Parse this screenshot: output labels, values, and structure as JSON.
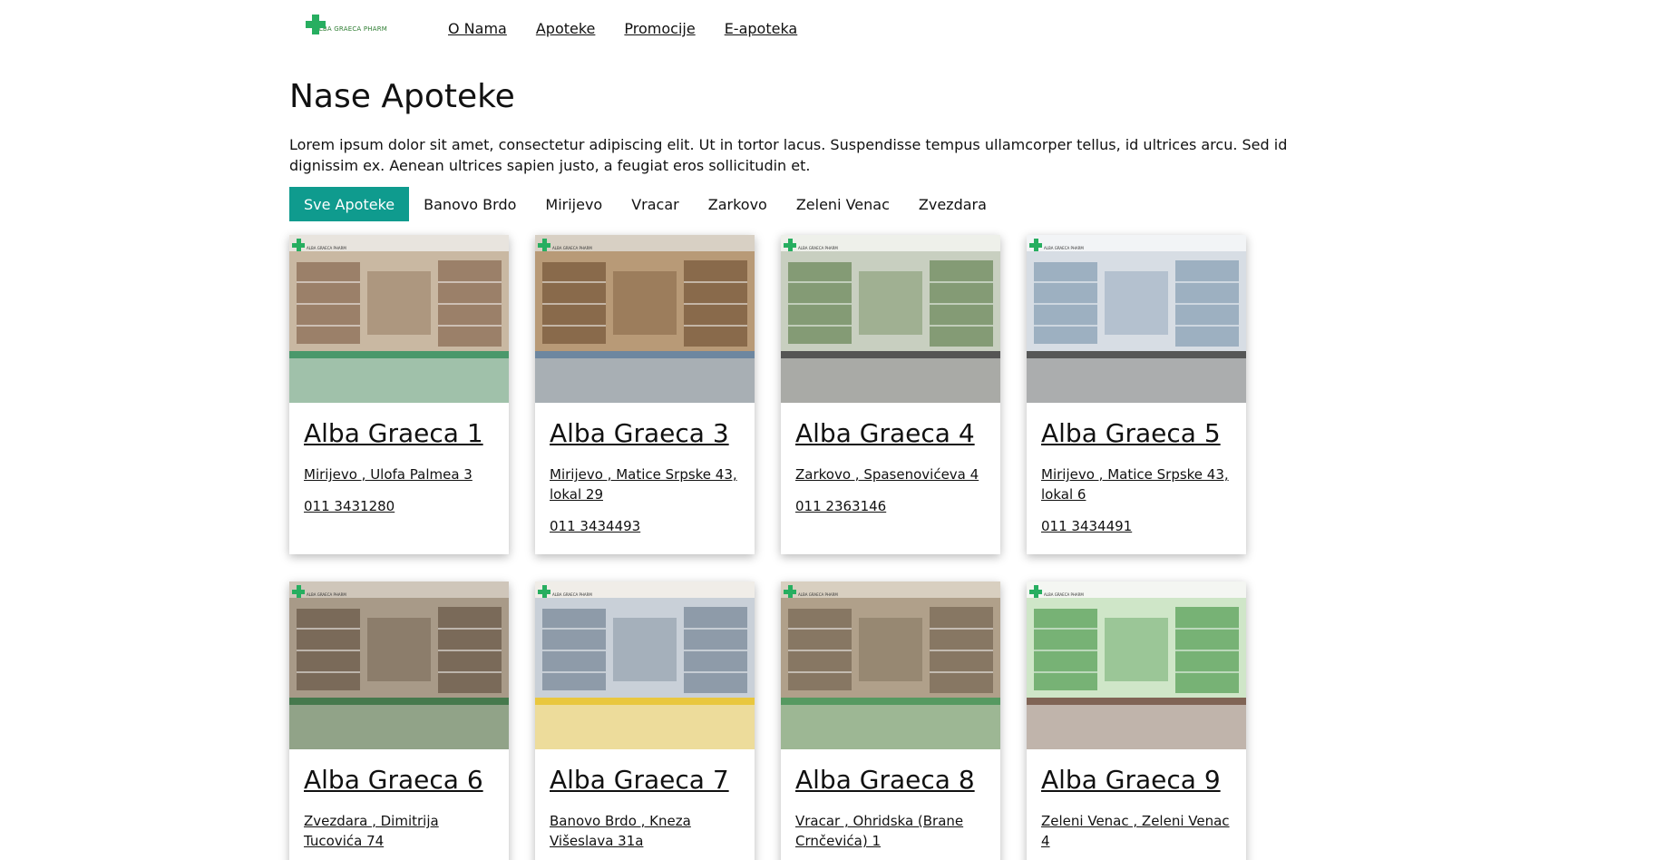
{
  "brand": {
    "logo_text": "ALBA GRAECA PHARM"
  },
  "nav": {
    "items": [
      "O Nama",
      "Apoteke",
      "Promocije",
      "E-apoteka"
    ]
  },
  "main": {
    "title": "Nase Apoteke",
    "intro": "Lorem ipsum dolor sit amet, consectetur adipiscing elit. Ut in tortor lacus. Suspendisse tempus ullamcorper tellus, id ultrices arcu. Sed id dignissim ex. Aenean ultrices sapien justo, a feugiat eros sollicitudin et.",
    "filters": [
      "Sve Apoteke",
      "Banovo Brdo",
      "Mirijevo",
      "Vracar",
      "Zarkovo",
      "Zeleni Venac",
      "Zvezdara"
    ],
    "active_filter": "Sve Apoteke"
  },
  "pharmacies": [
    {
      "name": "Alba Graeca 1",
      "address": "Mirijevo , Ulofa Palmea 3",
      "phone": "011 3431280",
      "palette": [
        "#8b6e55",
        "#c9b8a2",
        "#2e8b57",
        "#e8e4de"
      ]
    },
    {
      "name": "Alba Graeca 3",
      "address": "Mirijevo , Matice Srpske 43, lokal 29",
      "phone": "011 3434493",
      "palette": [
        "#7a5a3c",
        "#b89a77",
        "#5a7a9a",
        "#d8d0c4"
      ]
    },
    {
      "name": "Alba Graeca 4",
      "address": "Zarkovo , Spasenovićeva 4",
      "phone": "011 2363146",
      "palette": [
        "#6e8a5c",
        "#c8cfc0",
        "#3a3a3a",
        "#eef0ea"
      ]
    },
    {
      "name": "Alba Graeca 5",
      "address": "Mirijevo , Matice Srpske 43, lokal 6",
      "phone": "011 3434491",
      "palette": [
        "#8aa0b5",
        "#d7dde4",
        "#3b3b3b",
        "#f2f4f6"
      ]
    },
    {
      "name": "Alba Graeca 6",
      "address": "Zvezdara , Dimitrija Tucovića 74",
      "phone": "",
      "palette": [
        "#6b5a4a",
        "#a89a88",
        "#2e6b3a",
        "#cfc6ba"
      ]
    },
    {
      "name": "Alba Graeca 7",
      "address": "Banovo Brdo , Kneza Višeslava 31a",
      "phone": "",
      "palette": [
        "#7a8a9a",
        "#c9d0d8",
        "#e8c020",
        "#f0ede8"
      ]
    },
    {
      "name": "Alba Graeca 8",
      "address": "Vracar , Ohridska (Brane Crnčevića) 1",
      "phone": "",
      "palette": [
        "#7a6a55",
        "#b0a08a",
        "#3f8f50",
        "#d8cfc0"
      ]
    },
    {
      "name": "Alba Graeca 9",
      "address": "Zeleni Venac , Zeleni Venac 4",
      "phone": "",
      "palette": [
        "#5aa05a",
        "#cfe6c8",
        "#6b4a3a",
        "#f4f6f2"
      ]
    }
  ]
}
